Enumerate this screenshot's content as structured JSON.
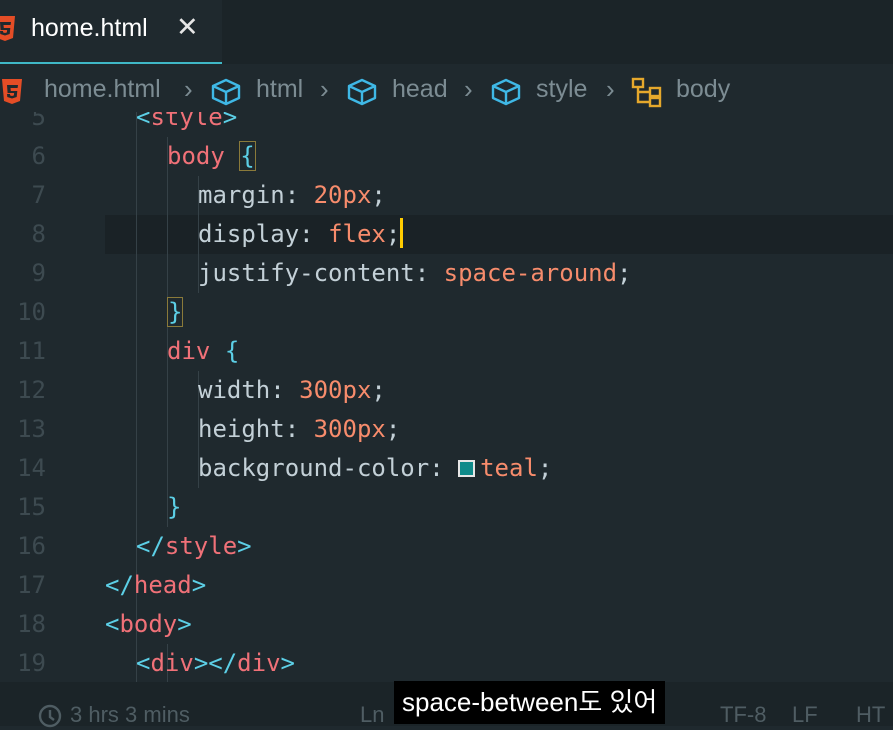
{
  "tab": {
    "label": "home.html",
    "close_glyph": "✕",
    "icon": "html5-icon"
  },
  "breadcrumb": [
    "home.html",
    "html",
    "head",
    "style",
    "body"
  ],
  "colors": {
    "tag": "#5ccfe6",
    "selector": "#f07178",
    "value": "#f78c6c",
    "swatch": "#0f8a8a",
    "caret": "#ffcc00"
  },
  "lines": [
    {
      "n": "5",
      "code": [
        {
          "t": "<",
          "c": "tag"
        },
        {
          "t": "style",
          "c": "tn"
        },
        {
          "t": ">",
          "c": "tag"
        }
      ]
    },
    {
      "n": "6",
      "code": [
        {
          "t": "body",
          "c": "tn"
        },
        {
          "t": " "
        },
        {
          "t": "{",
          "c": "brace"
        }
      ]
    },
    {
      "n": "7",
      "code": [
        {
          "t": "margin",
          "c": "prop"
        },
        {
          "t": ": ",
          "c": "pun"
        },
        {
          "t": "20px",
          "c": "val"
        },
        {
          "t": ";",
          "c": "pun"
        }
      ]
    },
    {
      "n": "8",
      "code": [
        {
          "t": "display",
          "c": "prop"
        },
        {
          "t": ": ",
          "c": "pun"
        },
        {
          "t": "flex",
          "c": "val"
        },
        {
          "t": ";",
          "c": "pun"
        }
      ]
    },
    {
      "n": "9",
      "code": [
        {
          "t": "justify-content",
          "c": "prop"
        },
        {
          "t": ": ",
          "c": "pun"
        },
        {
          "t": "space-around",
          "c": "val"
        },
        {
          "t": ";",
          "c": "pun"
        }
      ]
    },
    {
      "n": "10",
      "code": [
        {
          "t": "}",
          "c": "brace"
        }
      ]
    },
    {
      "n": "11",
      "code": [
        {
          "t": "div",
          "c": "tn"
        },
        {
          "t": " "
        },
        {
          "t": "{",
          "c": "tag"
        }
      ]
    },
    {
      "n": "12",
      "code": [
        {
          "t": "width",
          "c": "prop"
        },
        {
          "t": ": ",
          "c": "pun"
        },
        {
          "t": "300px",
          "c": "val"
        },
        {
          "t": ";",
          "c": "pun"
        }
      ]
    },
    {
      "n": "13",
      "code": [
        {
          "t": "height",
          "c": "prop"
        },
        {
          "t": ": ",
          "c": "pun"
        },
        {
          "t": "300px",
          "c": "val"
        },
        {
          "t": ";",
          "c": "pun"
        }
      ]
    },
    {
      "n": "14",
      "code": [
        {
          "t": "background-color",
          "c": "prop"
        },
        {
          "t": ": ",
          "c": "pun"
        },
        {
          "t": "teal",
          "c": "val"
        },
        {
          "t": ";",
          "c": "pun"
        }
      ]
    },
    {
      "n": "15",
      "code": [
        {
          "t": "}",
          "c": "tag"
        }
      ]
    },
    {
      "n": "16",
      "code": [
        {
          "t": "</",
          "c": "tag"
        },
        {
          "t": "style",
          "c": "tn"
        },
        {
          "t": ">",
          "c": "tag"
        }
      ]
    },
    {
      "n": "17",
      "code": [
        {
          "t": "</",
          "c": "tag"
        },
        {
          "t": "head",
          "c": "tn"
        },
        {
          "t": ">",
          "c": "tag"
        }
      ]
    },
    {
      "n": "18",
      "code": [
        {
          "t": "<",
          "c": "tag"
        },
        {
          "t": "body",
          "c": "tn"
        },
        {
          "t": ">",
          "c": "tag"
        }
      ]
    },
    {
      "n": "19",
      "code": [
        {
          "t": "<",
          "c": "tag"
        },
        {
          "t": "div",
          "c": "tn"
        },
        {
          "t": "></",
          "c": "tag"
        },
        {
          "t": "div",
          "c": "tn"
        },
        {
          "t": ">",
          "c": "tag"
        }
      ]
    }
  ],
  "status": {
    "history": "3 hrs 3 mins",
    "ln": "Ln",
    "encoding": "TF-8",
    "eol": "LF",
    "lang": "HT"
  },
  "subtitle": "space-between도 있어"
}
